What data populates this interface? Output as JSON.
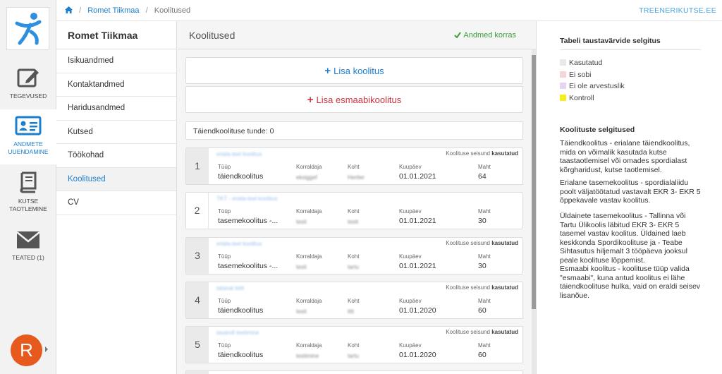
{
  "app": {
    "brand": "TREENERIKUTSE.EE"
  },
  "breadcrumb": {
    "person": "Romet Tiikmaa",
    "current": "Koolitused"
  },
  "rail": {
    "items": [
      {
        "label": "TEGEVUSED",
        "icon": "edit-icon"
      },
      {
        "label": "ANDMETE UUENDAMINE",
        "icon": "id-card-icon"
      },
      {
        "label": "KUTSE TAOTLEMINE",
        "icon": "book-icon"
      },
      {
        "label": "TEATED (1)",
        "icon": "mail-icon"
      }
    ],
    "avatar_initial": "R",
    "active_color": "#1a7fd1"
  },
  "submenu": {
    "title": "Romet Tiikmaa",
    "items": [
      "Isikuandmed",
      "Kontaktandmed",
      "Haridusandmed",
      "Kutsed",
      "Töökohad",
      "Koolitused",
      "CV"
    ],
    "active": "Koolitused"
  },
  "main": {
    "title": "Koolitused",
    "status": "Andmed korras",
    "add_training": "Lisa koolitus",
    "add_first_aid": "Lisa esmaabikoolitus",
    "hours_label": "Täiendkoolituse tunde: 0",
    "columns": {
      "type": "Tüüp",
      "organizer": "Korraldaja",
      "place": "Koht",
      "date": "Kuupäev",
      "volume": "Maht"
    },
    "state_label": "Koolituse seisund",
    "trainings": [
      {
        "num": "1",
        "name": "eriala-teel koolitus",
        "state": "kasutatud",
        "type": "täiendkoolitus",
        "organizer": "eksiggef",
        "place": "Hertier",
        "date": "01.01.2021",
        "volume": "64"
      },
      {
        "num": "2",
        "name": "TKT - eriala-teel koolitus",
        "state": "",
        "type": "tasemekoolitus -...",
        "organizer": "tesit",
        "place": "testt",
        "date": "01.01.2021",
        "volume": "30"
      },
      {
        "num": "3",
        "name": "eriala-teel koolitus",
        "state": "kasutatud",
        "type": "tasemekoolitus -...",
        "organizer": "tesit",
        "place": "tartu",
        "date": "01.01.2021",
        "volume": "30"
      },
      {
        "num": "4",
        "name": "tatanal tetit",
        "state": "kasutatud",
        "type": "täiendkoolitus",
        "organizer": "tesit",
        "place": "tttt",
        "date": "01.01.2020",
        "volume": "60"
      },
      {
        "num": "5",
        "name": "tasandl teetimine",
        "state": "kasutatud",
        "type": "täiendkoolitus",
        "organizer": "testimine",
        "place": "tartu",
        "date": "01.01.2020",
        "volume": "60"
      }
    ]
  },
  "help": {
    "legend_title": "Tabeli taustavärvide selgitus",
    "legend": [
      {
        "label": "Kasutatud",
        "color": "#e9e9e9"
      },
      {
        "label": "Ei sobi",
        "color": "#f5d5d8"
      },
      {
        "label": "Ei ole arvestuslik",
        "color": "#e6d4f2"
      },
      {
        "label": "Kontroll",
        "color": "#f7ef1a"
      }
    ],
    "explain_title": "Koolituste selgitused",
    "paragraphs": [
      "Täiendkoolitus - erialane täiendkoolitus, mida on võimalik kasutada kutse taastaotlemisel või omades spordialast kõrgharidust, kutse taotlemisel.",
      "Erialane tasemekoolitus - spordialaliidu poolt väljatöötatud vastavalt EKR 3- EKR 5 õppekavale vastav koolitus.",
      "Üldainete tasemekoolitus - Tallinna või Tartu Ülikoolis läbitud EKR 3- EKR 5 tasemel vastav koolitus. Üldained laeb keskkonda Spordikoolituse ja - Teabe Sihtasutus hiljemalt 3 tööpäeva jooksul peale koolituse lõppemist.",
      "Esmaabi koolitus - koolituse tüüp valida \"esmaabi\", kuna antud koolitus ei lähe täiendkoolituse hulka, vaid on eraldi seisev lisanõue."
    ]
  }
}
